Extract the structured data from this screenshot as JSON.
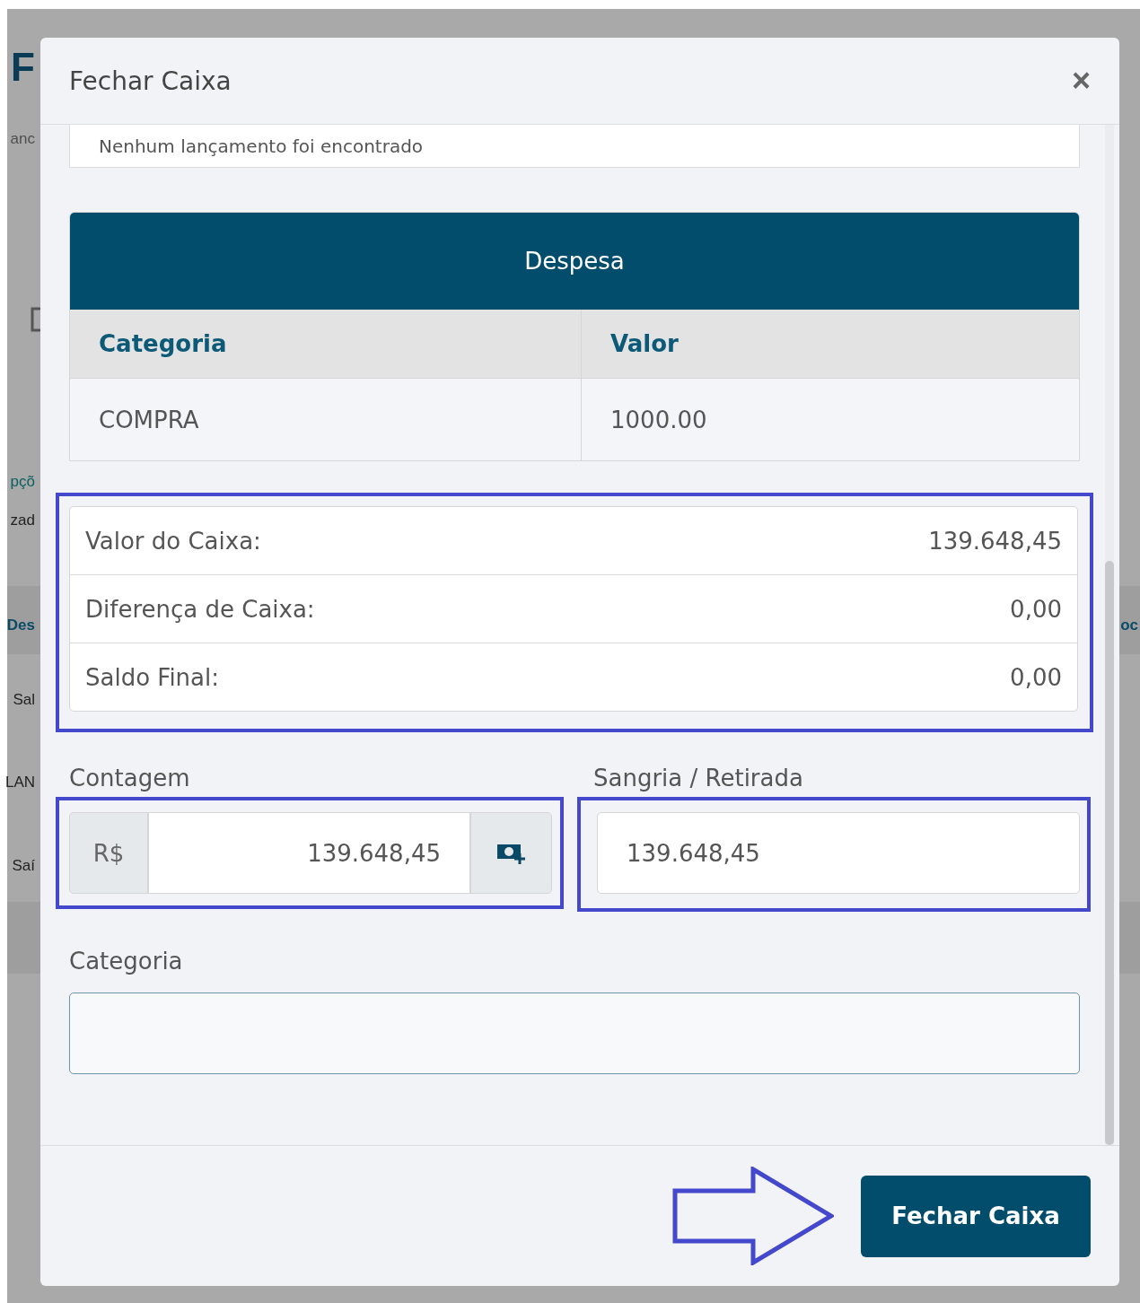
{
  "background": {
    "fragments": [
      {
        "kind": "title",
        "text": "F"
      },
      {
        "kind": "muted",
        "text": "anc"
      },
      {
        "kind": "link",
        "text": "pçõ"
      },
      {
        "kind": "text",
        "text": "zad"
      },
      {
        "kind": "header",
        "text": "Des"
      },
      {
        "kind": "text",
        "text": "Sal"
      },
      {
        "kind": "text",
        "text": "LAN"
      },
      {
        "kind": "text",
        "text": "Saí"
      },
      {
        "kind": "header_right",
        "text": "oc"
      }
    ]
  },
  "modal": {
    "title": "Fechar Caixa",
    "close": "×",
    "empty_message": "Nenhum lançamento foi encontrado",
    "expense_table": {
      "title": "Despesa",
      "columns": [
        "Categoria",
        "Valor"
      ],
      "rows": [
        [
          "COMPRA",
          "1000.00"
        ]
      ]
    },
    "summary": {
      "highlighted": true,
      "rows": [
        {
          "label": "Valor do Caixa:",
          "value": "139.648,45"
        },
        {
          "label": "Diferença de Caixa:",
          "value": "0,00"
        },
        {
          "label": "Saldo Final:",
          "value": "0,00"
        }
      ]
    },
    "contagem": {
      "label": "Contagem",
      "prefix": "R$",
      "value": "139.648,45",
      "highlighted": true
    },
    "sangria": {
      "label": "Sangria / Retirada",
      "value": "139.648,45",
      "highlighted": true
    },
    "categoria": {
      "label": "Categoria"
    },
    "footer": {
      "pointer_arrow": true,
      "button": "Fechar Caixa"
    }
  }
}
